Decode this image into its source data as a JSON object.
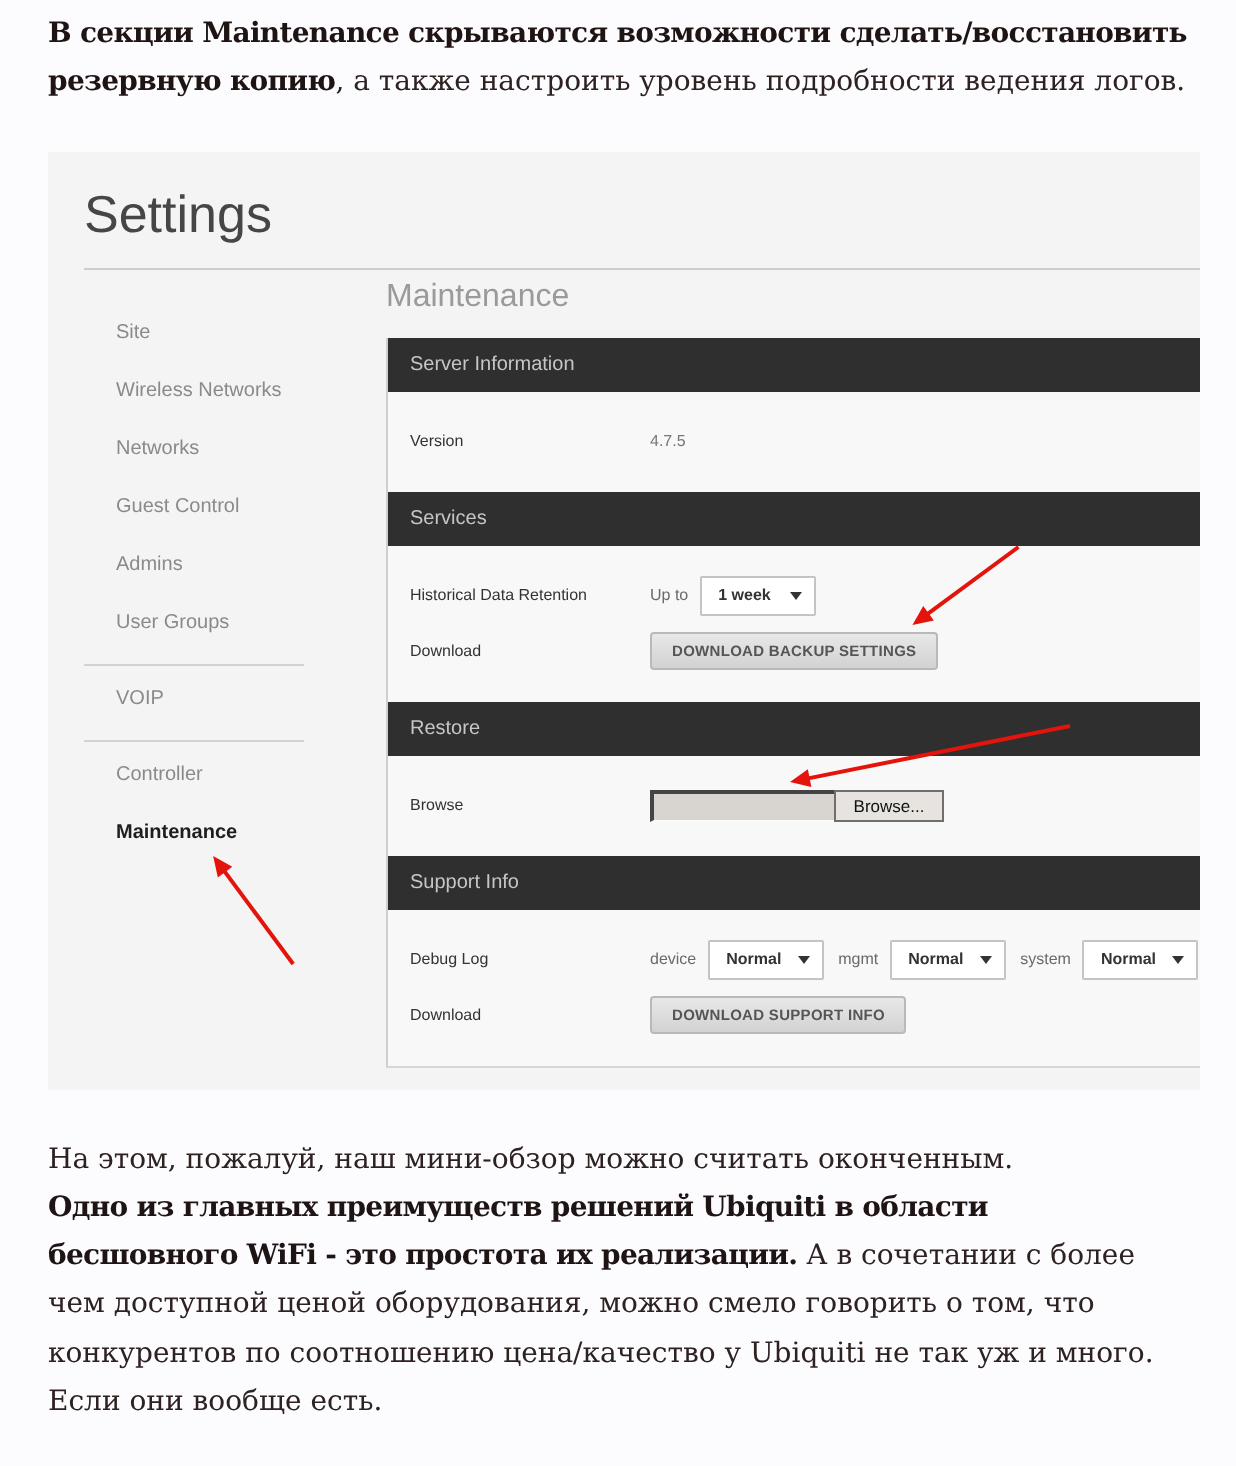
{
  "intro": "**В секции Maintenance скрываются возможности сделать/восстановить резервную копию**, а также настроить уровень подробности ведения логов.",
  "screenshot": {
    "title": "Settings",
    "sidebar": {
      "groups": [
        {
          "items": [
            {
              "label": "Site",
              "selected": false,
              "annotated": false
            },
            {
              "label": "Wireless Networks",
              "selected": false,
              "annotated": false
            },
            {
              "label": "Networks",
              "selected": false,
              "annotated": false
            },
            {
              "label": "Guest Control",
              "selected": false,
              "annotated": false
            },
            {
              "label": "Admins",
              "selected": false,
              "annotated": false
            },
            {
              "label": "User Groups",
              "selected": false,
              "annotated": false
            }
          ]
        },
        {
          "items": [
            {
              "label": "VOIP",
              "selected": false,
              "annotated": false
            }
          ]
        },
        {
          "items": [
            {
              "label": "Controller",
              "selected": false,
              "annotated": false
            },
            {
              "label": "Maintenance",
              "selected": true,
              "annotated": true
            }
          ]
        }
      ]
    },
    "heading": "Maintenance",
    "sections": [
      {
        "title": "Server Information",
        "annotated": false,
        "rows": [
          {
            "kind": "text",
            "label": "Version",
            "value": "4.7.5"
          }
        ]
      },
      {
        "title": "Services",
        "annotated": true,
        "rows": [
          {
            "kind": "select",
            "label": "Historical Data Retention",
            "selects": [
              {
                "prefix": "Up to",
                "value": "1 week"
              }
            ]
          },
          {
            "kind": "button",
            "label": "Download",
            "button": "DOWNLOAD BACKUP SETTINGS"
          }
        ]
      },
      {
        "title": "Restore",
        "annotated": true,
        "rows": [
          {
            "kind": "file",
            "label": "Browse",
            "button": "Browse..."
          }
        ]
      },
      {
        "title": "Support Info",
        "annotated": false,
        "rows": [
          {
            "kind": "select",
            "label": "Debug Log",
            "selects": [
              {
                "prefix": "device",
                "value": "Normal"
              },
              {
                "prefix": "mgmt",
                "value": "Normal"
              },
              {
                "prefix": "system",
                "value": "Normal"
              }
            ]
          },
          {
            "kind": "button",
            "label": "Download",
            "button": "DOWNLOAD SUPPORT INFO"
          }
        ]
      }
    ]
  },
  "outro": [
    "На этом, пожалуй, наш мини-обзор можно считать оконченным.",
    "**Одно из главных преимуществ решений Ubiquiti в области бесшовного WiFi - это простота их реализации.** А в сочетании с более чем доступной ценой оборудования, можно смело говорить о том, что конкурентов по соотношению цена/качество у Ubiquiti не так уж и много. Если они вообще есть."
  ]
}
